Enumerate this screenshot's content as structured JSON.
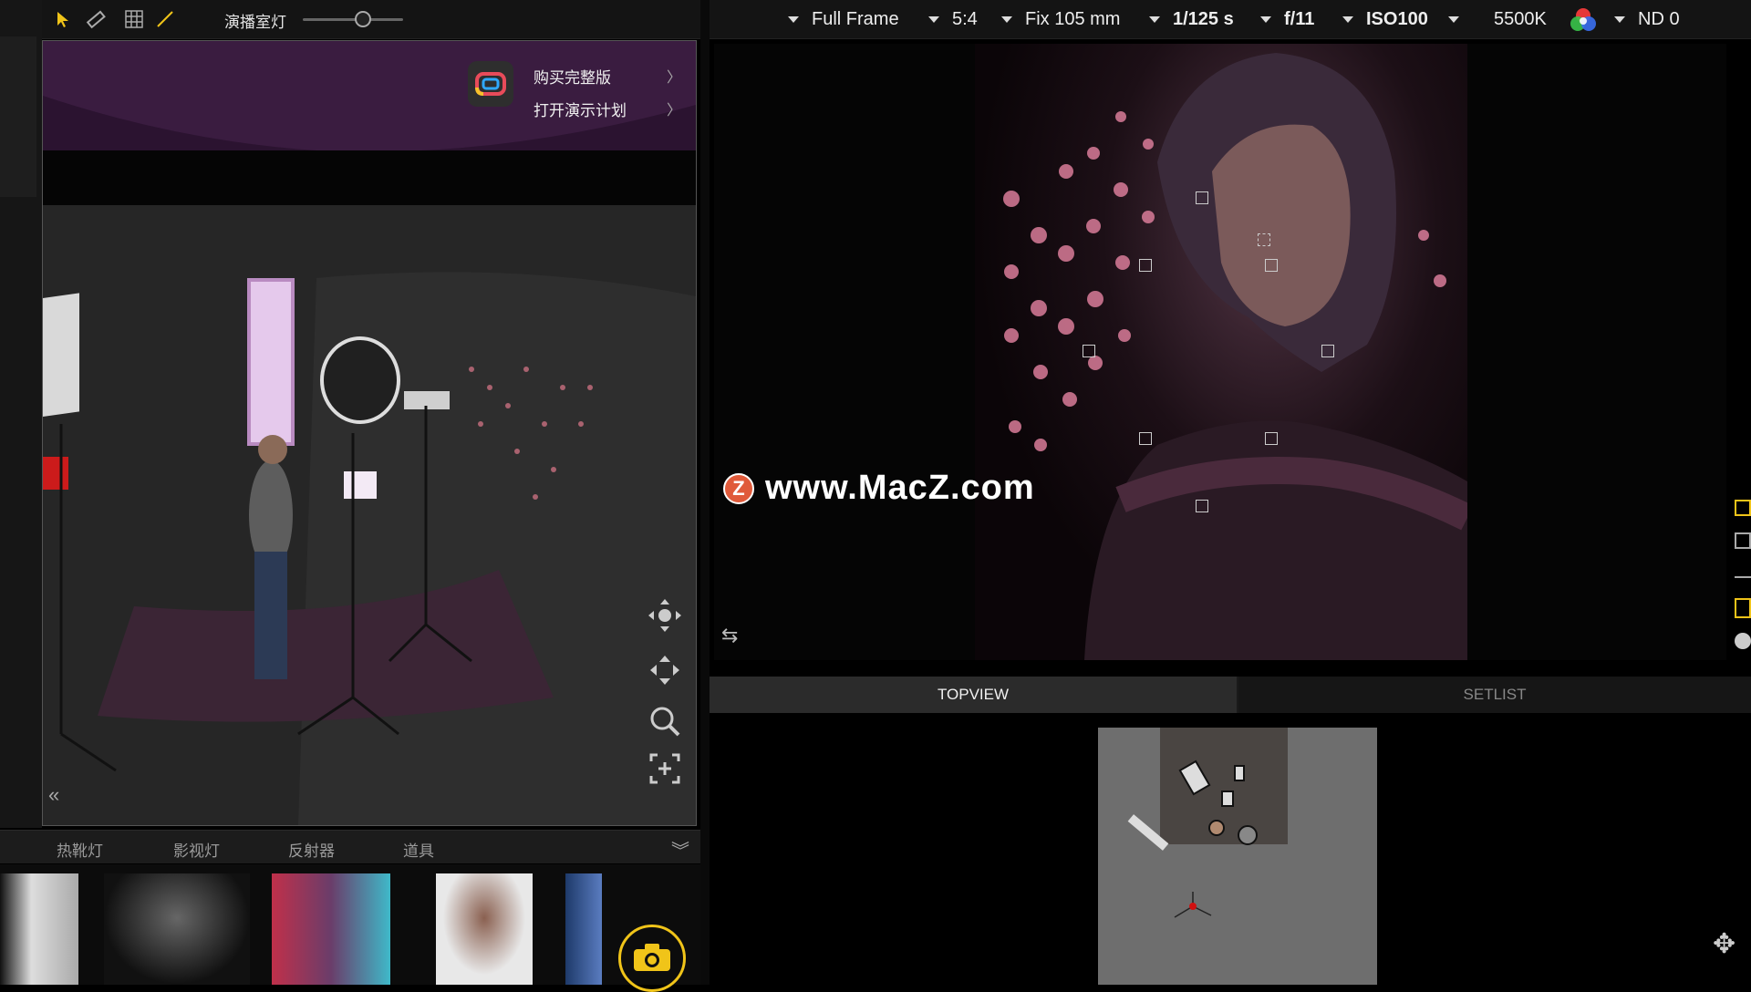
{
  "toolbar": {
    "studio_light_label": "演播室灯",
    "studio_light_level": 0.6
  },
  "upgrade_menu": {
    "buy_full": "购买完整版",
    "open_demo": "打开演示计划",
    "chevron": "〉"
  },
  "camera": {
    "sensor": "Full Frame",
    "ratio": "5:4",
    "lens": "Fix 105 mm",
    "shutter": "1/125 s",
    "aperture": "f/11",
    "iso": "ISO100",
    "white_balance": "5500K",
    "nd": "ND 0"
  },
  "watermark": {
    "badge": "Z",
    "text": "www.MacZ.com"
  },
  "panel_tabs": {
    "topview": "TOPVIEW",
    "setlist": "SETLIST"
  },
  "asset_tabs": [
    "热靴灯",
    "影视灯",
    "反射器",
    "道具"
  ],
  "colors": {
    "accent": "#f0c419",
    "active_tab": "#2b2b2b"
  }
}
